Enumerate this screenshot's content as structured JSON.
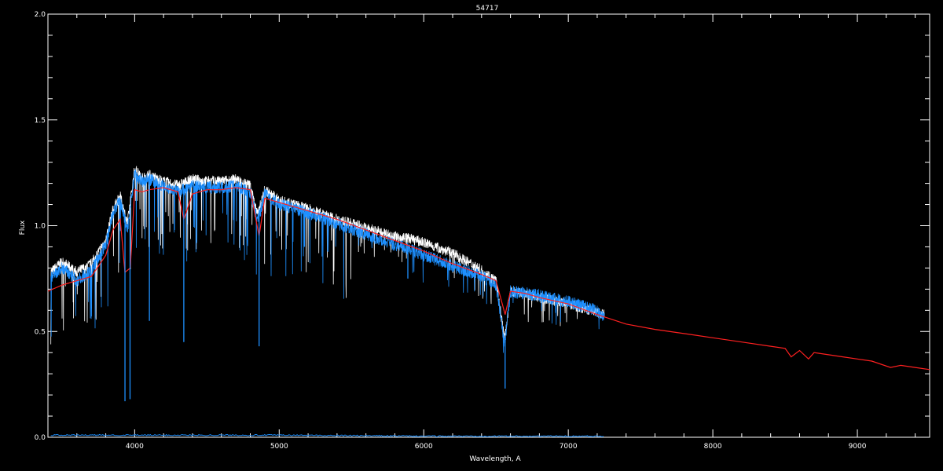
{
  "chart_data": {
    "type": "line",
    "title": "54717",
    "xlabel": "Wavelength, A",
    "ylabel": "Flux",
    "xlim": [
      3400,
      9500
    ],
    "ylim": [
      0.0,
      2.0
    ],
    "x_ticks": [
      4000,
      5000,
      6000,
      7000,
      8000,
      9000
    ],
    "y_ticks": [
      0.0,
      0.5,
      1.0,
      1.5,
      2.0
    ],
    "y_tick_labels": [
      "0.0",
      "0.5",
      "1.0",
      "1.5",
      "2.0"
    ],
    "grid": false,
    "colors": {
      "background": "#000000",
      "axes": "#ffffff",
      "observed": "#ffffff",
      "smoothed": "#1e90ff",
      "model": "#ff2020",
      "error": "#1e90ff"
    },
    "series": [
      {
        "color": "#ffffff",
        "x": [
          3420,
          3500,
          3600,
          3700,
          3800,
          3850,
          3900,
          3950,
          4000,
          4050,
          4100,
          4200,
          4300,
          4400,
          4500,
          4600,
          4700,
          4800,
          4850,
          4900,
          5000,
          5200,
          5400,
          5600,
          5800,
          5900,
          6000,
          6200,
          6400,
          6500,
          6560,
          6600,
          6700,
          6800,
          7000,
          7100,
          7200,
          7250
        ],
        "y": [
          0.78,
          0.83,
          0.78,
          0.82,
          0.93,
          1.08,
          1.14,
          1.01,
          1.27,
          1.23,
          1.24,
          1.21,
          1.19,
          1.22,
          1.21,
          1.21,
          1.22,
          1.19,
          1.05,
          1.17,
          1.12,
          1.08,
          1.03,
          0.99,
          0.95,
          0.94,
          0.92,
          0.87,
          0.79,
          0.74,
          0.46,
          0.69,
          0.68,
          0.66,
          0.63,
          0.61,
          0.59,
          0.58
        ]
      },
      {
        "color": "#1e90ff",
        "x": [
          3420,
          3500,
          3600,
          3700,
          3800,
          3850,
          3900,
          3950,
          4000,
          4050,
          4100,
          4200,
          4300,
          4400,
          4500,
          4600,
          4700,
          4800,
          4850,
          4900,
          5000,
          5200,
          5400,
          5600,
          5800,
          5900,
          6000,
          6200,
          6400,
          6500,
          6560,
          6600,
          6700,
          6800,
          7000,
          7100,
          7200,
          7250
        ],
        "y": [
          0.75,
          0.8,
          0.74,
          0.79,
          0.91,
          1.06,
          1.12,
          0.98,
          1.25,
          1.21,
          1.22,
          1.19,
          1.16,
          1.19,
          1.18,
          1.18,
          1.19,
          1.16,
          1.02,
          1.15,
          1.1,
          1.06,
          1.01,
          0.96,
          0.91,
          0.89,
          0.86,
          0.81,
          0.76,
          0.72,
          0.44,
          0.69,
          0.68,
          0.67,
          0.64,
          0.62,
          0.6,
          0.57
        ]
      },
      {
        "color": "#ff2020",
        "x": [
          3400,
          3500,
          3600,
          3700,
          3800,
          3850,
          3900,
          3933,
          3970,
          4000,
          4050,
          4100,
          4200,
          4300,
          4340,
          4400,
          4500,
          4600,
          4700,
          4800,
          4861,
          4900,
          5000,
          5200,
          5400,
          5600,
          5800,
          6000,
          6200,
          6400,
          6500,
          6563,
          6600,
          6700,
          6800,
          7000,
          7200,
          7400,
          7600,
          7800,
          8000,
          8200,
          8400,
          8500,
          8542,
          8600,
          8662,
          8700,
          8800,
          8900,
          9000,
          9100,
          9229,
          9300,
          9400,
          9500
        ],
        "y": [
          0.69,
          0.72,
          0.74,
          0.76,
          0.86,
          0.98,
          1.03,
          0.78,
          0.8,
          1.17,
          1.16,
          1.17,
          1.18,
          1.16,
          1.03,
          1.15,
          1.17,
          1.17,
          1.18,
          1.17,
          0.95,
          1.13,
          1.11,
          1.07,
          1.03,
          0.98,
          0.93,
          0.88,
          0.82,
          0.77,
          0.74,
          0.58,
          0.69,
          0.68,
          0.66,
          0.63,
          0.58,
          0.535,
          0.51,
          0.49,
          0.47,
          0.45,
          0.43,
          0.42,
          0.38,
          0.41,
          0.37,
          0.4,
          0.39,
          0.38,
          0.37,
          0.36,
          0.33,
          0.34,
          0.33,
          0.32
        ]
      }
    ],
    "absorption_lines": [
      {
        "x": 3933,
        "y": 0.17
      },
      {
        "x": 3968,
        "y": 0.18
      },
      {
        "x": 4102,
        "y": 0.55
      },
      {
        "x": 4340,
        "y": 0.45
      },
      {
        "x": 4861,
        "y": 0.43
      },
      {
        "x": 5175,
        "y": 0.9
      },
      {
        "x": 5890,
        "y": 0.75
      },
      {
        "x": 6563,
        "y": 0.23
      }
    ],
    "error_series": {
      "color": "#1e90ff",
      "x": [
        3420,
        4000,
        5000,
        6000,
        7000,
        7250
      ],
      "y": [
        0.01,
        0.01,
        0.01,
        0.005,
        0.005,
        0.005
      ]
    }
  }
}
